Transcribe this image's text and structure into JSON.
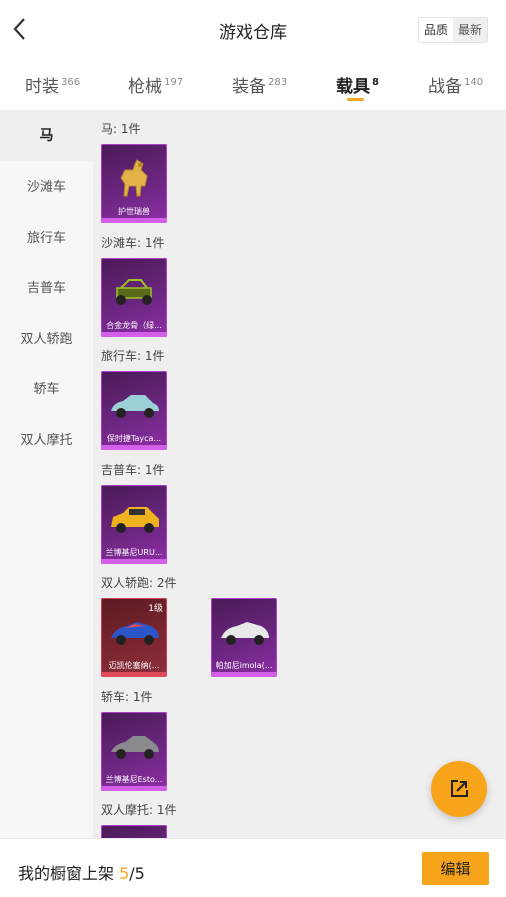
{
  "header": {
    "title": "游戏仓库",
    "sort_quality": "品质",
    "sort_newest": "最新"
  },
  "tabs": [
    {
      "label": "时装",
      "count": "366"
    },
    {
      "label": "枪械",
      "count": "197"
    },
    {
      "label": "装备",
      "count": "283"
    },
    {
      "label": "载具",
      "count": "8"
    },
    {
      "label": "战备",
      "count": "140"
    }
  ],
  "sidebar": [
    "马",
    "沙滩车",
    "旅行车",
    "吉普车",
    "双人轿跑",
    "轿车",
    "双人摩托"
  ],
  "groups": [
    {
      "label": "马: 1件",
      "items": [
        {
          "name": "护世瑞兽"
        }
      ]
    },
    {
      "label": "沙滩车: 1件",
      "items": [
        {
          "name": "合金龙骨（绿..."
        }
      ]
    },
    {
      "label": "旅行车: 1件",
      "items": [
        {
          "name": "保时捷Tayca..."
        }
      ]
    },
    {
      "label": "吉普车: 1件",
      "items": [
        {
          "name": "兰博基尼URU..."
        }
      ]
    },
    {
      "label": "双人轿跑: 2件",
      "items": [
        {
          "name": "迈凯伦塞纳(...",
          "level": "1级"
        },
        {
          "name": "帕加尼imola(..."
        }
      ]
    },
    {
      "label": "轿车: 1件",
      "items": [
        {
          "name": "兰博基尼Esto..."
        }
      ]
    },
    {
      "label": "双人摩托: 1件",
      "items": []
    }
  ],
  "footer": {
    "prefix": "我的橱窗上架 ",
    "current": "5",
    "separator": "/",
    "total": "5",
    "edit_label": "编辑"
  },
  "colors": {
    "accent": "#f5a623",
    "card_purple": "#6b2680",
    "card_red": "#7b2530"
  },
  "icons": {
    "back": "chevron-left-icon",
    "share": "share-external-icon"
  }
}
